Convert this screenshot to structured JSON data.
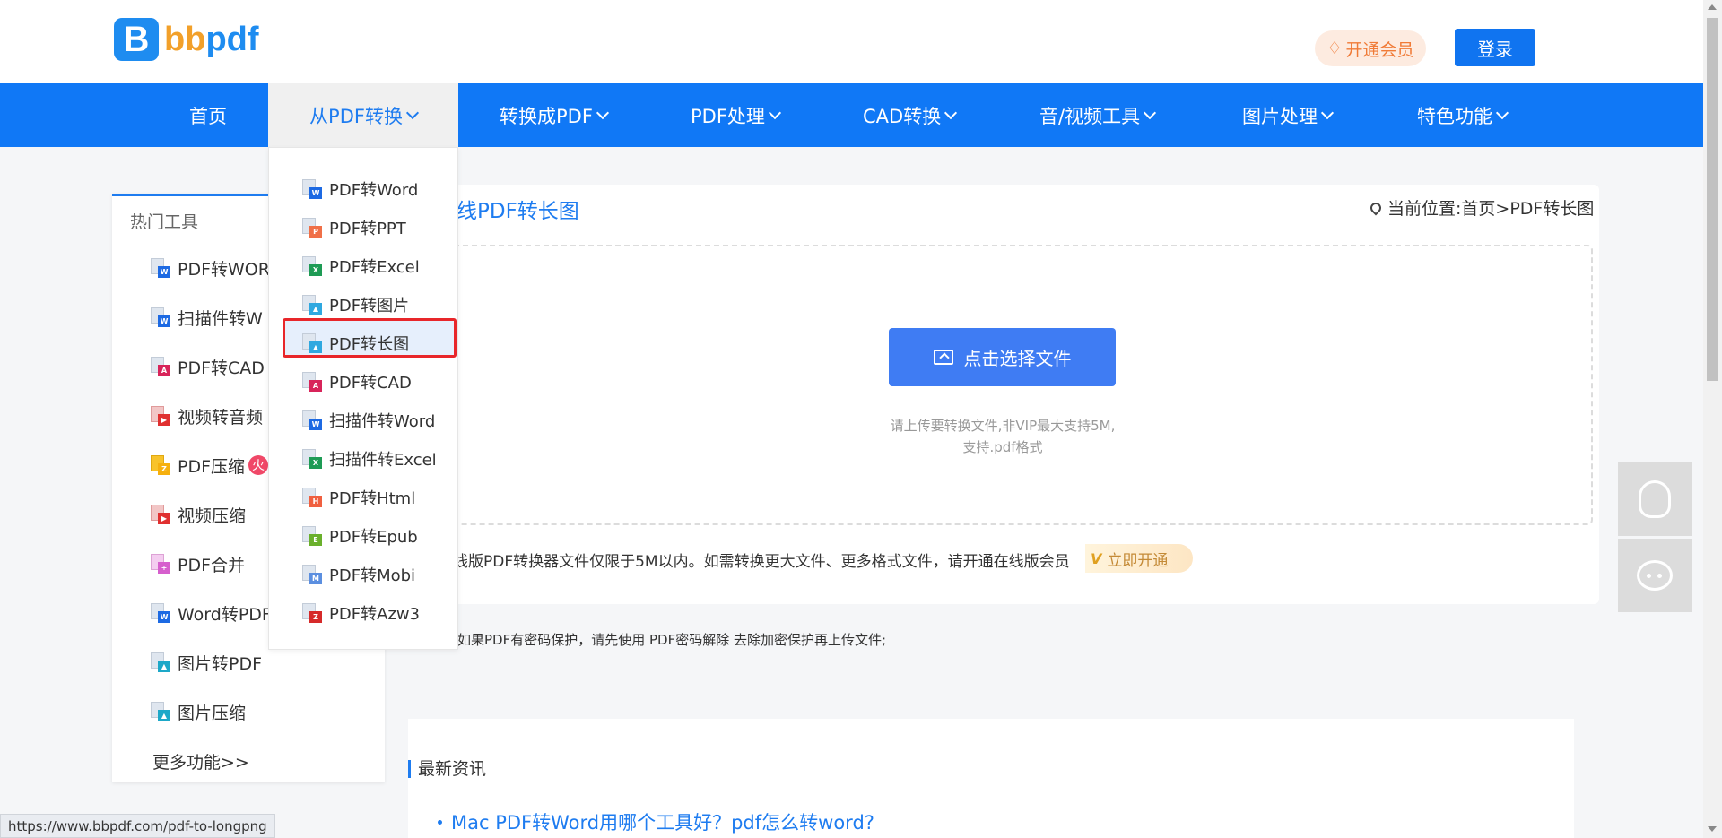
{
  "header": {
    "logo_letter": "B",
    "logo_text_part1": "bb",
    "logo_text_part2": "pdf",
    "vip_label": "开通会员",
    "login_label": "登录"
  },
  "nav": {
    "items": [
      {
        "label": "首页",
        "dropdown": false
      },
      {
        "label": "从PDF转换",
        "dropdown": true,
        "active": true
      },
      {
        "label": "转换成PDF",
        "dropdown": true
      },
      {
        "label": "PDF处理",
        "dropdown": true
      },
      {
        "label": "CAD转换",
        "dropdown": true
      },
      {
        "label": "音/视频工具",
        "dropdown": true
      },
      {
        "label": "图片处理",
        "dropdown": true
      },
      {
        "label": "特色功能",
        "dropdown": true
      }
    ]
  },
  "dropdown": {
    "items": [
      {
        "label": "PDF转Word",
        "icon": "word-file-icon",
        "badge": "W"
      },
      {
        "label": "PDF转PPT",
        "icon": "ppt-file-icon",
        "badge": "P"
      },
      {
        "label": "PDF转Excel",
        "icon": "excel-file-icon",
        "badge": "X"
      },
      {
        "label": "PDF转图片",
        "icon": "image-file-icon",
        "badge": "▲"
      },
      {
        "label": "PDF转长图",
        "icon": "long-image-file-icon",
        "badge": "▲",
        "highlighted": true
      },
      {
        "label": "PDF转CAD",
        "icon": "cad-file-icon",
        "badge": "A"
      },
      {
        "label": "扫描件转Word",
        "icon": "word-file-icon",
        "badge": "W"
      },
      {
        "label": "扫描件转Excel",
        "icon": "excel-file-icon",
        "badge": "X"
      },
      {
        "label": "PDF转Html",
        "icon": "html-file-icon",
        "badge": "H"
      },
      {
        "label": "PDF转Epub",
        "icon": "epub-file-icon",
        "badge": "E"
      },
      {
        "label": "PDF转Mobi",
        "icon": "mobi-file-icon",
        "badge": "M"
      },
      {
        "label": "PDF转Azw3",
        "icon": "azw3-file-icon",
        "badge": "Z"
      }
    ]
  },
  "sidebar": {
    "title": "热门工具",
    "items": [
      {
        "label": "PDF转WOR",
        "icon": "word-file-icon",
        "badge": "W"
      },
      {
        "label": "扫描件转W",
        "icon": "word-file-icon",
        "badge": "W"
      },
      {
        "label": "PDF转CAD",
        "icon": "cad-file-icon",
        "badge": "A"
      },
      {
        "label": "视频转音频",
        "icon": "video-file-icon",
        "badge": "▶"
      },
      {
        "label": "PDF压缩",
        "icon": "zip-file-icon",
        "badge": "Z",
        "hot": true
      },
      {
        "label": "视频压缩",
        "icon": "video-file-icon",
        "badge": "▶"
      },
      {
        "label": "PDF合并",
        "icon": "merge-file-icon",
        "badge": "+"
      },
      {
        "label": "Word转PDF",
        "icon": "word-file-icon",
        "badge": "W"
      },
      {
        "label": "图片转PDF",
        "icon": "image-file-icon",
        "badge": "▲"
      },
      {
        "label": "图片压缩",
        "icon": "image-file-icon",
        "badge": "▲"
      }
    ],
    "more_label": "更多功能>>",
    "hot_badge": "火"
  },
  "main": {
    "title": "线PDF转长图",
    "breadcrumb": "当前位置:首页>PDF转长图",
    "upload_button": "点击选择文件",
    "hint_line1": "请上传要转换文件,非VIP最大支持5M,",
    "hint_line2": "支持.pdf格式",
    "limit_note": "线版PDF转换器文件仅限于5M以内。如需转换更大文件、更多格式文件，请开通在线版会员",
    "vip_tag": "V",
    "open_now": "立即开通",
    "password_note_prefix": "如果PDF有密码保护，请先使用",
    "password_note_link": "PDF密码解除",
    "password_note_suffix": "去除加密保护再上传文件;",
    "news_title": "最新资讯",
    "news_items": [
      {
        "label": "Mac PDF转Word用哪个工具好？pdf怎么转word?"
      }
    ]
  },
  "statusbar": {
    "url": "https://www.bbpdf.com/pdf-to-longpng"
  },
  "colors": {
    "brand_blue": "#1078f6",
    "highlight_red": "#e8262a",
    "upload_button": "#3f7cf3"
  }
}
